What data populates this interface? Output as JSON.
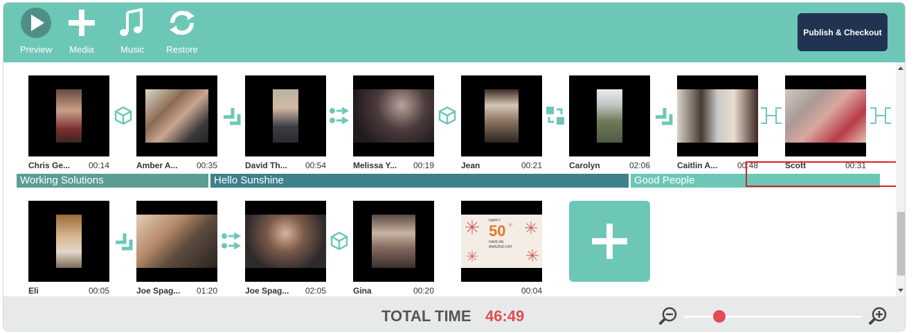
{
  "toolbar": {
    "preview_label": "Preview",
    "media_label": "Media",
    "music_label": "Music",
    "restore_label": "Restore",
    "publish_label": "Publish & Checkout"
  },
  "chapters": [
    {
      "label": "Working Solutions",
      "color": "#5a9e93"
    },
    {
      "label": "Hello Sunshine",
      "color": "#3d818a"
    },
    {
      "label": "Good People",
      "color": "#6dc7b7"
    }
  ],
  "clips": [
    {
      "name": "Chris Ge...",
      "duration": "00:14"
    },
    {
      "name": "Amber A...",
      "duration": "00:35"
    },
    {
      "name": "David Th...",
      "duration": "00:54"
    },
    {
      "name": "Melissa Y...",
      "duration": "00:19"
    },
    {
      "name": "Jean",
      "duration": "00:21"
    },
    {
      "name": "Carolyn",
      "duration": "02:06"
    },
    {
      "name": "Caitlin A...",
      "duration": "00:48"
    },
    {
      "name": "Scott",
      "duration": "00:31"
    },
    {
      "name": "Eli",
      "duration": "00:05"
    },
    {
      "name": "Joe Spag...",
      "duration": "01:20"
    },
    {
      "name": "Joe Spag...",
      "duration": "02:05"
    },
    {
      "name": "Gina",
      "duration": "00:20"
    },
    {
      "name": "",
      "duration": "00:04"
    }
  ],
  "birthday_card": {
    "line1": "HAPPY",
    "big": "50",
    "sup": "th",
    "line2": "HAVE AN",
    "line3": "AMAZING DAY"
  },
  "footer": {
    "total_label": "TOTAL TIME",
    "total_value": "46:49"
  },
  "zoom_level": 0.2,
  "colors": {
    "accent": "#6dc7b7",
    "publish": "#223352",
    "total": "#e14d52"
  }
}
